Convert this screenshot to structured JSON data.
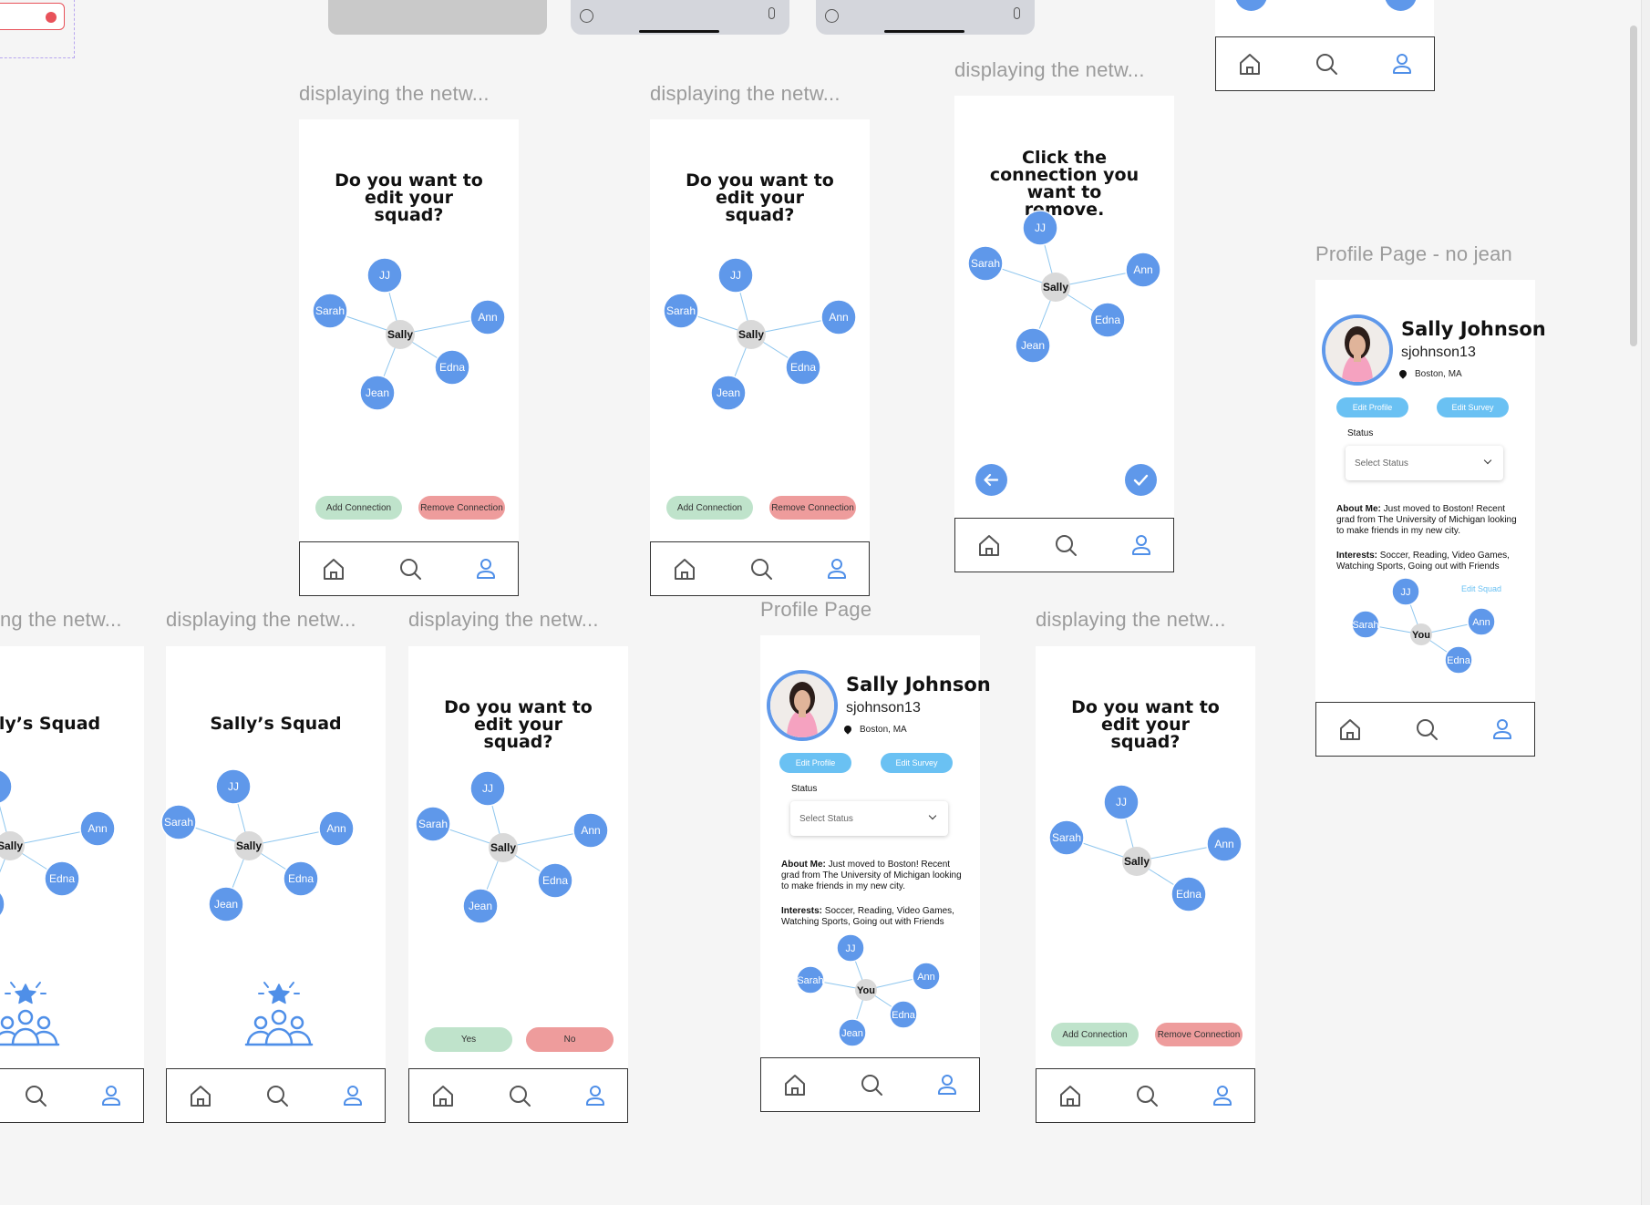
{
  "labels": {
    "display": "displaying the netw...",
    "display_cut": "ng the netw...",
    "profile_page": "Profile Page",
    "profile_nojean": "Profile Page - no jean"
  },
  "texts": {
    "edit_question": "Do you want to edit your squad?",
    "remove_instruction": "Click the connection you want to remove.",
    "squad_title": "Sally’s Squad",
    "squad_title_cut": "lly’s Squad"
  },
  "buttons": {
    "add_connection": "Add Connection",
    "remove_connection": "Remove Connection",
    "yes": "Yes",
    "no": "No",
    "edit_profile": "Edit Profile",
    "edit_survey": "Edit Survey",
    "edit_squad": "Edit Squad"
  },
  "graph_nodes": {
    "center": "Sally",
    "you": "You",
    "jj": "JJ",
    "sarah": "Sarah",
    "ann": "Ann",
    "edna": "Edna",
    "jean": "Jean"
  },
  "profile": {
    "name": "Sally Johnson",
    "username": "sjohnson13",
    "location": "Boston, MA",
    "status_label": "Status",
    "status_placeholder": "Select Status",
    "about_label": "About Me:",
    "about_text": "Just moved to Boston! Recent grad from The University of Michigan looking to make friends in my new city.",
    "interests_label": "Interests:",
    "interests_text": "Soccer, Reading, Video Games, Watching Sports, Going out with Friends"
  },
  "nav_icons": [
    "home-icon",
    "search-icon",
    "profile-icon"
  ],
  "colors": {
    "node_blue": "#5f98ea",
    "node_center": "#d9d9d9",
    "edge": "#8ec6ee",
    "add_green": "#bfe3cb",
    "remove_red": "#ee9c9c",
    "edit_blue": "#6ac1f3",
    "icon_blue": "#4f8fe8",
    "icon_gray": "#555555"
  }
}
